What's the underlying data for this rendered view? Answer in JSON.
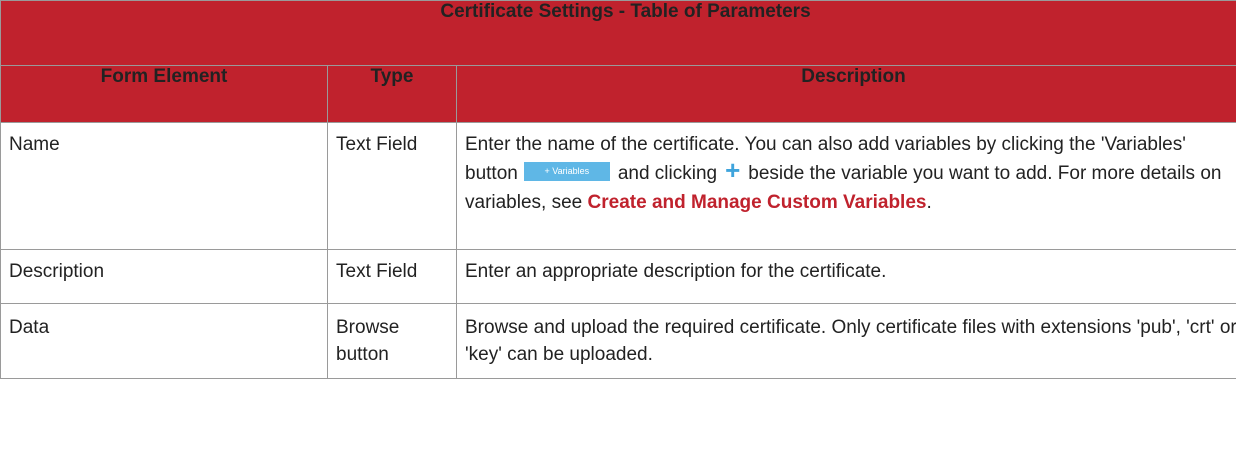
{
  "table": {
    "title": "Certificate Settings - Table of Parameters",
    "headers": {
      "form_element": "Form Element",
      "type": "Type",
      "description": "Description"
    },
    "rows": [
      {
        "element": "Name",
        "type": "Text Field",
        "desc_part1": "Enter the name of the certificate. You can also add variables by clicking the 'Variables' button",
        "variables_button": "+ Variables",
        "desc_part2": "and clicking",
        "plus_icon": "+",
        "desc_part3": "beside the variable you want to add. For more details on variables, see",
        "link_text": "Create and Manage Custom Variables",
        "desc_end": "."
      },
      {
        "element": "Description",
        "type": "Text Field",
        "description": "Enter an appropriate description for the certificate."
      },
      {
        "element": "Data",
        "type": "Browse button",
        "description": "Browse and upload the required certificate. Only certificate files with extensions 'pub', 'crt' or 'key' can be uploaded."
      }
    ]
  },
  "colors": {
    "header_bg": "#c0222d",
    "link": "#c0222d",
    "variables_button_bg": "#5fb7e6",
    "plus_icon": "#3fa4dc"
  },
  "icons": {
    "plus": "plus-icon"
  }
}
